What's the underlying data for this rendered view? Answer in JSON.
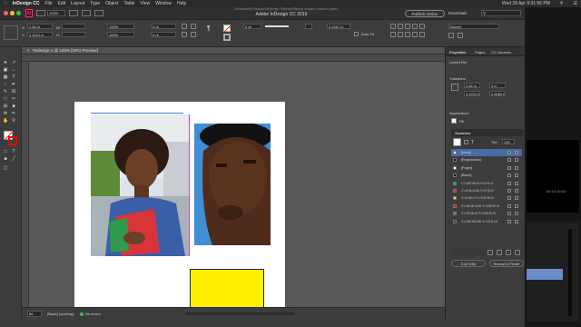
{
  "menubar": {
    "app": "InDesign CC",
    "items": [
      "File",
      "Edit",
      "Layout",
      "Type",
      "Object",
      "Table",
      "View",
      "Window",
      "Help"
    ],
    "right_time": "Wed 28 Apr  9:31:56 PM"
  },
  "window": {
    "title": "Adobe InDesign CC 2019",
    "zoom": "100%",
    "publish_label": "Publish Online",
    "workspace": "Essentials",
    "path_title": "/Volumes/My Passport/InDesign Tutorials/Placing Images/ Lesson/ Layers"
  },
  "control": {
    "x": "2.84 in",
    "y": "3.4241 in",
    "w": "",
    "h": "",
    "pt": "0 pt",
    "pct": "100%",
    "stroke_wt": "0 pt",
    "fit_val": "0.1667 in",
    "auto_fit": "Auto-Fit",
    "style": "[None]"
  },
  "document": {
    "tab": "*Indesign-1 @ 100% [GPU Preview]"
  },
  "status": {
    "page": "86",
    "style": "[Basic] (working)",
    "errors": "No errors"
  },
  "panels": {
    "tabs": [
      "Properties",
      "Pages",
      "CC Libraries"
    ],
    "linked_file": "Linked File",
    "transform": "Transform",
    "t_x": "2.84 in",
    "t_y": "3.4241 in",
    "t_w": "4 in",
    "t_h": "0.6082 in",
    "appearance": "Appearance",
    "fill_label": "Fill",
    "swatches_tab": "Swatches",
    "tint_label": "Tint:",
    "tint_value": "100",
    "swatches": [
      {
        "name": "[None]",
        "color": "#ffffff",
        "selected": true
      },
      {
        "name": "[Registration]",
        "color": "#000000"
      },
      {
        "name": "[Paper]",
        "color": "#ffffff"
      },
      {
        "name": "[Black]",
        "color": "#000000"
      },
      {
        "name": "C=100 M=0 Y=0 K=0",
        "color": "#00a0e9"
      },
      {
        "name": "C=0 M=100 Y=0 K=0",
        "color": "#e4007f"
      },
      {
        "name": "C=0 M=0 Y=100 K=0",
        "color": "#fff100"
      },
      {
        "name": "C=15 M=100 Y=100 K=0",
        "color": "#c8161d"
      },
      {
        "name": "C=75 M=5 Y=100 K=0",
        "color": "#1aa33a"
      },
      {
        "name": "C=100 M=90 Y=10 K=0",
        "color": "#1d3b8f"
      }
    ],
    "edit_with": "Edit With",
    "reveal_finder": "Reveal in Finder"
  },
  "premiere": {
    "timecode": "00:14:16:03"
  }
}
